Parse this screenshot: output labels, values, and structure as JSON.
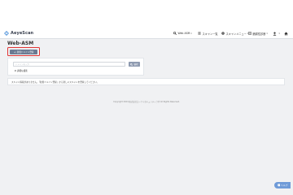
{
  "header": {
    "brand": "AeyeScan",
    "nav": {
      "product": "Web ASM",
      "scan_list": "スキャン一覧",
      "scan_menu": "スキャンメニュー",
      "reports": "脆弱性診断",
      "user_menu": "",
      "home": ""
    }
  },
  "page": {
    "title": "Web-ASM"
  },
  "toolbar": {
    "add_label": "新規ドメイン登録"
  },
  "search": {
    "placeholder": "ドメインを入力",
    "button_label": "検索",
    "detail_toggle": "詳細な検索"
  },
  "message": "スキャン情報がありません。「新規ドメイン登録」から新しいスキャンを登録してください。",
  "footer": "Copyright 2024 株式会社エーアイセキュリティラボ All Rights Reserved.",
  "help": {
    "label": "ヘルプ"
  },
  "colors": {
    "header_bg": "#ffffff",
    "page_bg": "#f0f1f3",
    "primary_button": "#6b7a92",
    "search_button": "#8e9ab0",
    "highlight": "#e03434",
    "help_button": "#6f9bd8"
  },
  "icons": {
    "logo": "aeyescan-logo-icon",
    "product": "magnifier-icon",
    "scan_list": "list-icon",
    "scan_menu": "gear-icon",
    "reports": "report-icon",
    "user": "user-icon",
    "home": "home-icon",
    "add": "plus-icon",
    "search": "search-icon",
    "help": "question-icon"
  }
}
